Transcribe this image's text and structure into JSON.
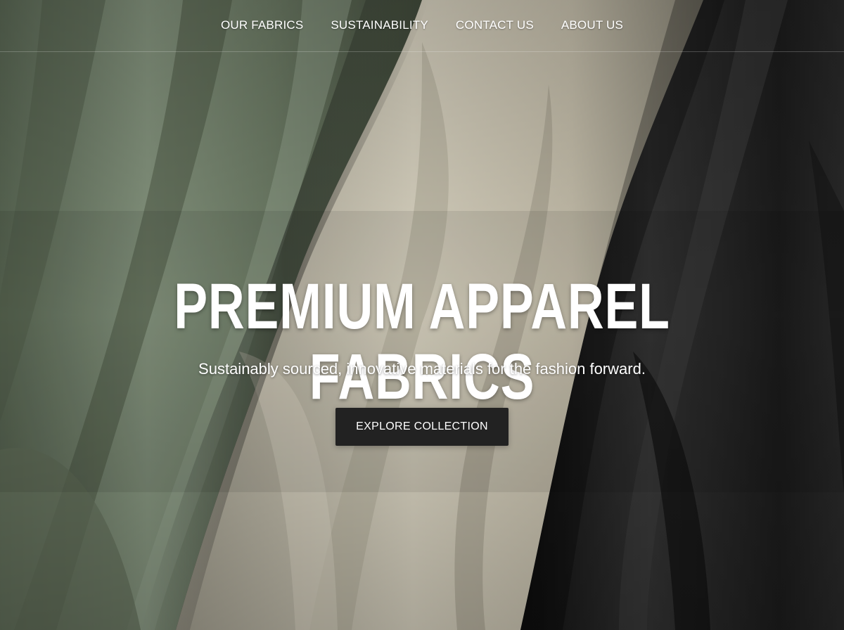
{
  "nav": {
    "items": [
      {
        "label": "OUR FABRICS"
      },
      {
        "label": "SUSTAINABILITY"
      },
      {
        "label": "CONTACT US"
      },
      {
        "label": "ABOUT US"
      }
    ]
  },
  "hero": {
    "headline": "PREMIUM APPAREL FABRICS",
    "subheadline": "Sustainably sourced, innovative materials for the fashion forward.",
    "cta_label": "EXPLORE COLLECTION",
    "background": "draped-fabric-photo"
  },
  "colors": {
    "sage_fabric": "#7b8a74",
    "cream_fabric": "#d8d1bf",
    "charcoal_fabric": "#242424",
    "button_bg": "#222222",
    "text": "#ffffff"
  }
}
